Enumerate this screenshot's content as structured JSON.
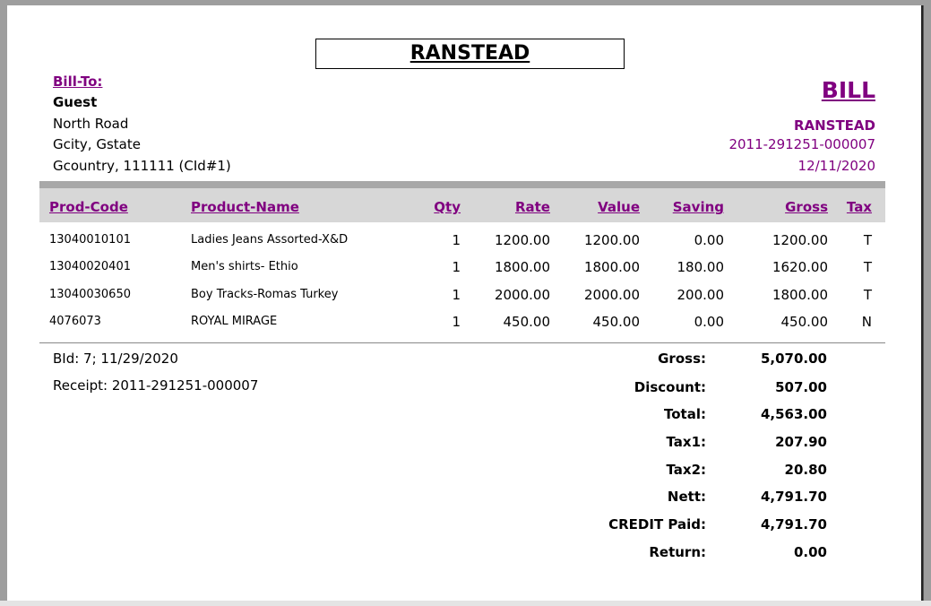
{
  "store_header": "RANSTEAD",
  "bill_to": {
    "label": "Bill-To:",
    "name": "Guest",
    "line1": "North Road",
    "line2": "Gcity, Gstate",
    "line3": "Gcountry, 111111 (CId#1)"
  },
  "bill": {
    "title": "BILL",
    "store": "RANSTEAD",
    "number": "2011-291251-000007",
    "date": "12/11/2020"
  },
  "columns": {
    "code": "Prod-Code",
    "name": "Product-Name",
    "qty": "Qty",
    "rate": "Rate",
    "value": "Value",
    "saving": "Saving",
    "gross": "Gross",
    "tax": "Tax"
  },
  "items": [
    {
      "code": "13040010101",
      "name": "Ladies Jeans Assorted-X&D",
      "qty": "1",
      "rate": "1200.00",
      "value": "1200.00",
      "saving": "0.00",
      "gross": "1200.00",
      "tax": "T"
    },
    {
      "code": "13040020401",
      "name": "Men's shirts- Ethio",
      "qty": "1",
      "rate": "1800.00",
      "value": "1800.00",
      "saving": "180.00",
      "gross": "1620.00",
      "tax": "T"
    },
    {
      "code": "13040030650",
      "name": "Boy Tracks-Romas Turkey",
      "qty": "1",
      "rate": "2000.00",
      "value": "2000.00",
      "saving": "200.00",
      "gross": "1800.00",
      "tax": "T"
    },
    {
      "code": "4076073",
      "name": "ROYAL MIRAGE",
      "qty": "1",
      "rate": "450.00",
      "value": "450.00",
      "saving": "0.00",
      "gross": "450.00",
      "tax": "N"
    }
  ],
  "info": {
    "bid": "BId: 7; 11/29/2020",
    "receipt": "Receipt: 2011-291251-000007"
  },
  "totals": [
    {
      "label": "Gross:",
      "value": "5,070.00"
    },
    {
      "label": "Discount:",
      "value": "507.00"
    },
    {
      "label": "Total:",
      "value": "4,563.00"
    },
    {
      "label": "Tax1:",
      "value": "207.90"
    },
    {
      "label": "Tax2:",
      "value": "20.80"
    },
    {
      "label": "Nett:",
      "value": "4,791.70"
    },
    {
      "label": "CREDIT Paid:",
      "value": "4,791.70"
    },
    {
      "label": "Return:",
      "value": "0.00"
    }
  ],
  "colors": {
    "accent": "#800080"
  }
}
